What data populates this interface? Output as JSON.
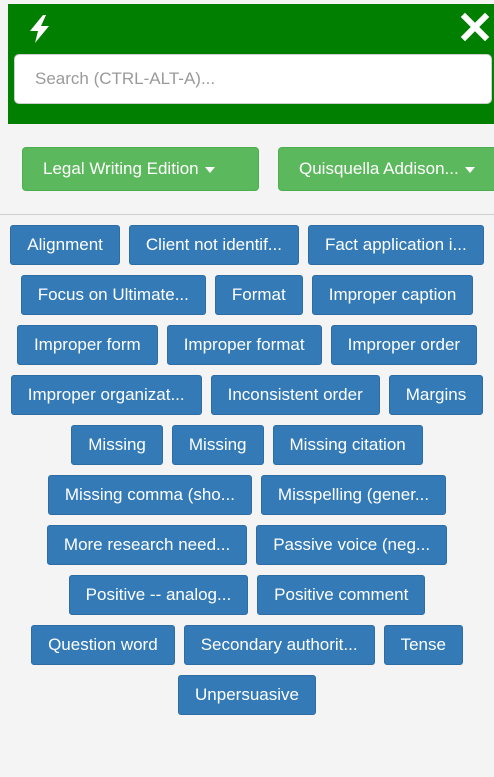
{
  "header": {
    "bolt_icon": "lightning-bolt-icon",
    "close_icon": "close-icon",
    "background_color": "#017f01"
  },
  "search": {
    "placeholder": "Search (CTRL-ALT-A)...",
    "value": ""
  },
  "dropdowns": {
    "edition_label": "Legal Writing Edition",
    "user_label": "Quisquella Addison...",
    "button_color": "#5cb85c"
  },
  "tags": {
    "button_color": "#337ab7",
    "items": [
      "Alignment",
      "Client not identif...",
      "Fact application i...",
      "Focus on Ultimate...",
      "Format",
      "Improper caption",
      "Improper form",
      "Improper format",
      "Improper order",
      "Improper organizat...",
      "Inconsistent order",
      "Margins",
      "Missing",
      "Missing",
      "Missing citation",
      "Missing comma (sho...",
      "Misspelling (gener...",
      "More research need...",
      "Passive voice (neg...",
      "Positive -- analog...",
      "Positive comment",
      "Question word",
      "Secondary authorit...",
      "Tense",
      "Unpersuasive"
    ]
  }
}
